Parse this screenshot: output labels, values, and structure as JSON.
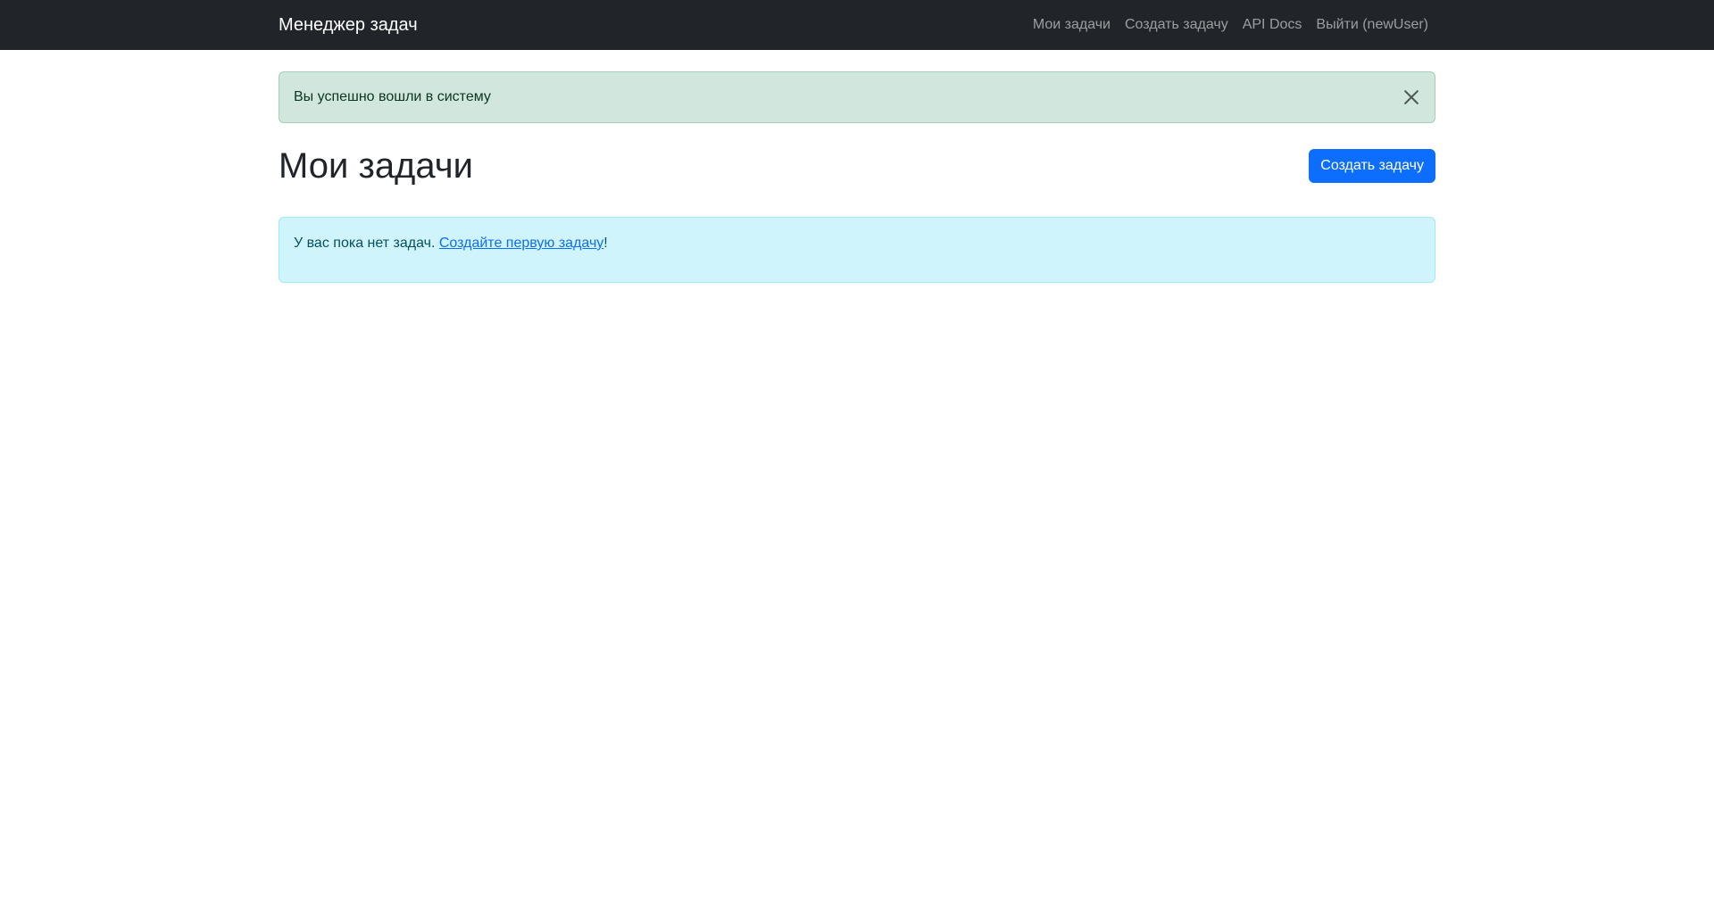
{
  "navbar": {
    "brand": "Менеджер задач",
    "links": [
      {
        "label": "Мои задачи"
      },
      {
        "label": "Создать задачу"
      },
      {
        "label": "API Docs"
      },
      {
        "label": "Выйти (newUser)"
      }
    ]
  },
  "flash": {
    "message": "Вы успешно вошли в систему",
    "close_icon": "close-icon"
  },
  "main": {
    "title": "Мои задачи",
    "create_button": "Создать задачу",
    "empty_prefix": "У вас пока нет задач. ",
    "empty_link": "Создайте первую задачу",
    "empty_suffix": "!"
  },
  "colors": {
    "navbar_bg": "#212529",
    "primary": "#0d6efd",
    "success_bg": "#d1e7dd",
    "info_bg": "#cff4fc"
  }
}
